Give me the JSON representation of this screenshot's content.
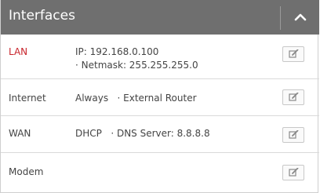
{
  "panel": {
    "title": "Interfaces",
    "collapse_icon": "chevron-up-icon"
  },
  "interfaces": [
    {
      "name": "LAN",
      "name_color": "#c8252c",
      "detail_line1": "IP: 192.168.0.100",
      "detail_line2": "· Netmask: 255.255.255.0",
      "edit_icon": "edit-icon"
    },
    {
      "name": "Internet",
      "name_color": "#444444",
      "detail_line1": "Always   · External Router",
      "edit_icon": "edit-icon"
    },
    {
      "name": "WAN",
      "name_color": "#444444",
      "detail_line1": "DHCP   · DNS Server: 8.8.8.8",
      "edit_icon": "edit-icon"
    },
    {
      "name": "Modem",
      "name_color": "#444444",
      "detail_line1": "",
      "edit_icon": "edit-icon"
    }
  ]
}
